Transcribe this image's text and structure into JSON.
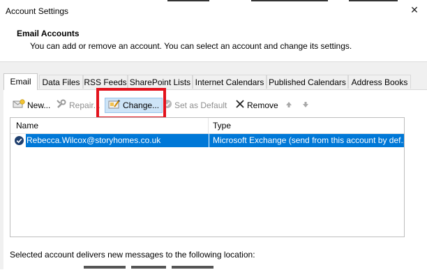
{
  "window": {
    "title": "Account Settings"
  },
  "header": {
    "title": "Email Accounts",
    "description": "You can add or remove an account. You can select an account and change its settings."
  },
  "tabs": [
    {
      "label": "Email",
      "active": true
    },
    {
      "label": "Data Files",
      "active": false
    },
    {
      "label": "RSS Feeds",
      "active": false
    },
    {
      "label": "SharePoint Lists",
      "active": false
    },
    {
      "label": "Internet Calendars",
      "active": false
    },
    {
      "label": "Published Calendars",
      "active": false
    },
    {
      "label": "Address Books",
      "active": false
    }
  ],
  "toolbar": {
    "new_label": "New...",
    "repair_label": "Repair...",
    "change_label": "Change...",
    "set_default_label": "Set as Default",
    "remove_label": "Remove"
  },
  "accounts_table": {
    "columns": [
      "Name",
      "Type"
    ],
    "rows": [
      {
        "name": "Rebecca.Wilcox@storyhomes.co.uk",
        "type": "Microsoft Exchange (send from this account by def...",
        "selected": true,
        "is_default": true
      }
    ]
  },
  "delivery": {
    "text": "Selected account delivers new messages to the following location:"
  },
  "colors": {
    "selection": "#0078d7",
    "highlight_box": "#e3121c",
    "dialog_bg": "#f0f0f0"
  }
}
